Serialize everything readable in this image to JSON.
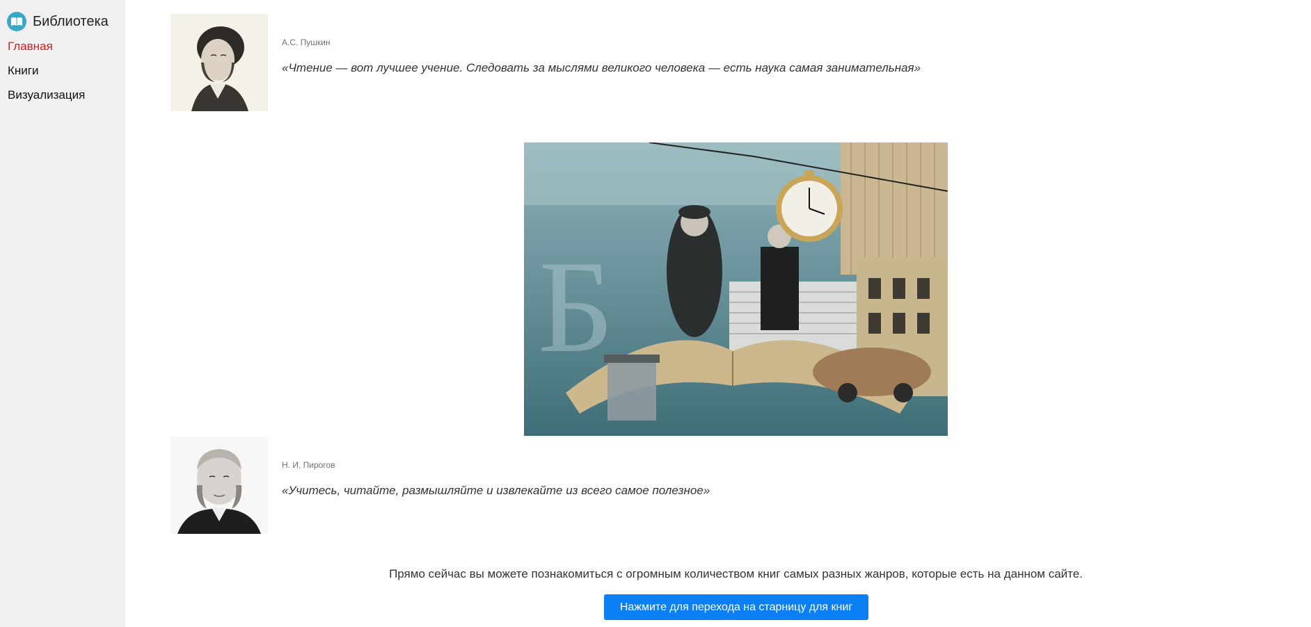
{
  "sidebar": {
    "brand": {
      "title": "Библиотека",
      "icon": "book-icon"
    },
    "items": [
      {
        "label": "Главная",
        "active": true
      },
      {
        "label": "Книги",
        "active": false
      },
      {
        "label": "Визуализация",
        "active": false
      }
    ]
  },
  "quotes": [
    {
      "author": "А.С. Пушкин",
      "text": "«Чтение — вот лучшее учение. Следовать за мыслями великого человека — есть наука самая занимательная»",
      "portrait": "pushkin-portrait"
    },
    {
      "author": "Н. И. Пирогов",
      "text": "«Учитесь, читайте, размышляйте и извлекайте из всего самое полезное»",
      "portrait": "pirogov-portrait"
    }
  ],
  "main": {
    "promo_text": "Прямо сейчас вы можете познакомиться с огромным количеством книг самых разных жанров, которые есть на данном сайте.",
    "cta_label": "Нажмите для перехода на старницу для книг"
  },
  "colors": {
    "accent": "#0d7ff5",
    "active_nav": "#e8141b",
    "sidebar_bg": "#f0f0f0",
    "brand_icon": "#3aa7c4"
  }
}
